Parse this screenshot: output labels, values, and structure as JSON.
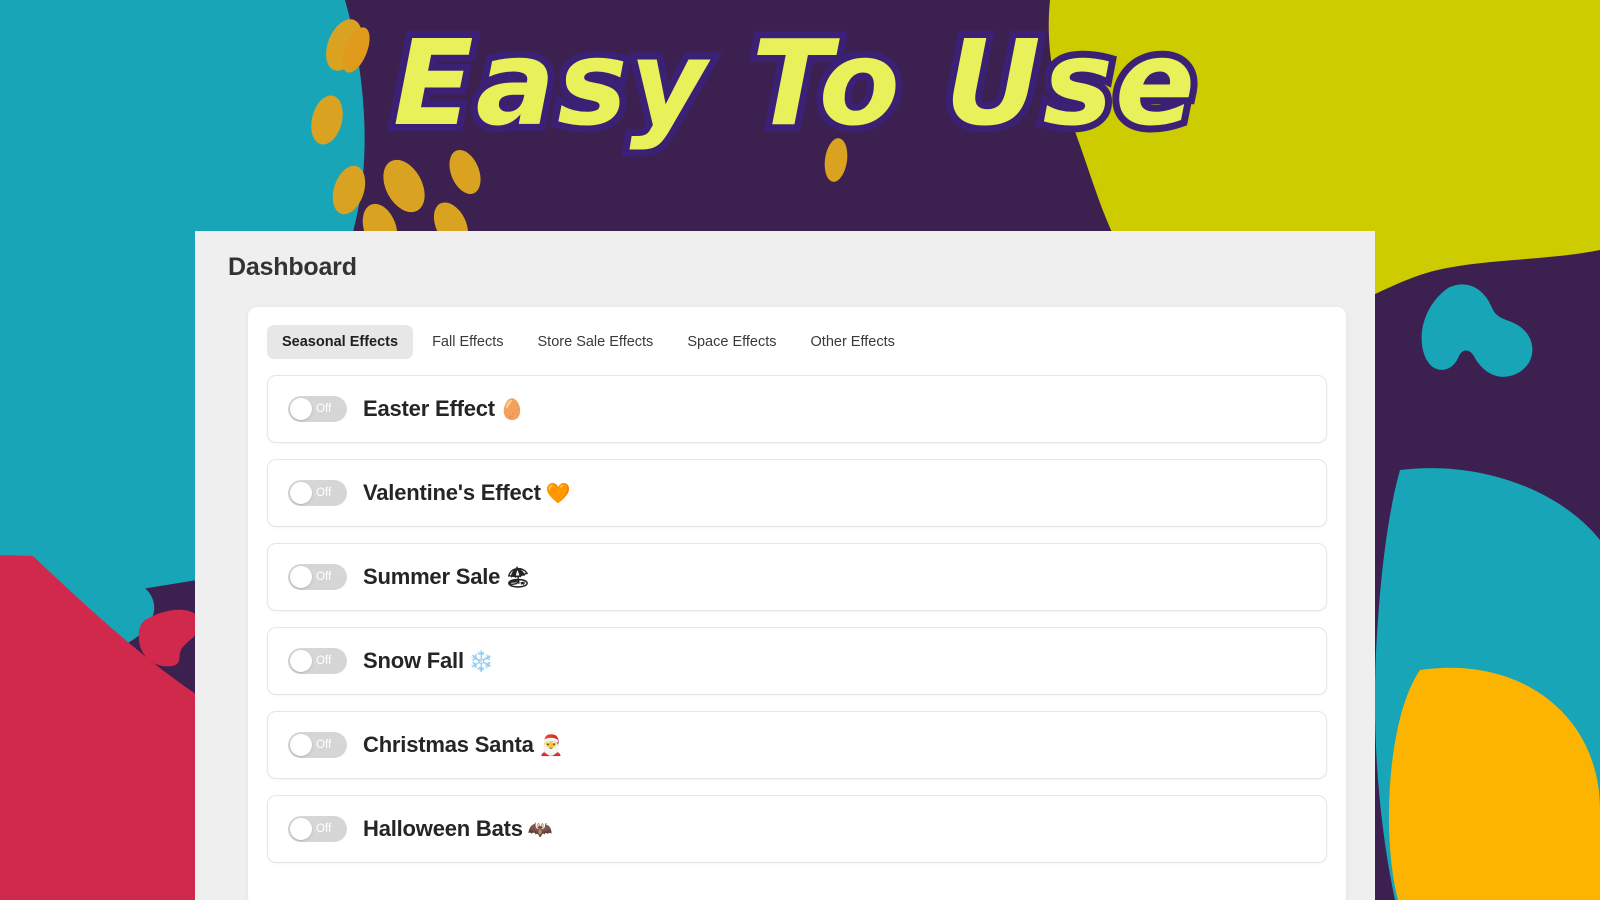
{
  "hero": {
    "headline": "Easy To Use",
    "text_color": "#E8F05A",
    "outline_color": "#3A2175"
  },
  "background": {
    "purple": "#3C2050",
    "teal": "#18A5B8",
    "chartreuse": "#CCCC00",
    "orange": "#FCB400",
    "crimson": "#D0294B",
    "gold": "#D9A321"
  },
  "app": {
    "page_title": "Dashboard",
    "surface_color": "#EFEFEF",
    "tabs": [
      {
        "label": "Seasonal Effects",
        "active": true
      },
      {
        "label": "Fall Effects",
        "active": false
      },
      {
        "label": "Store Sale Effects",
        "active": false
      },
      {
        "label": "Space Effects",
        "active": false
      },
      {
        "label": "Other Effects",
        "active": false
      }
    ],
    "toggle_off_label": "Off",
    "effects": [
      {
        "name": "Easter Effect",
        "emoji": "🥚",
        "state": "Off",
        "icon": "egg-icon"
      },
      {
        "name": "Valentine's Effect",
        "emoji": "🧡",
        "state": "Off",
        "icon": "orange-heart-icon"
      },
      {
        "name": "Summer Sale",
        "emoji": "🏖",
        "state": "Off",
        "icon": "beach-umbrella-icon"
      },
      {
        "name": "Snow Fall",
        "emoji": "❄️",
        "state": "Off",
        "icon": "snowflake-icon"
      },
      {
        "name": "Christmas Santa",
        "emoji": "🎅",
        "state": "Off",
        "icon": "santa-icon"
      },
      {
        "name": "Halloween Bats",
        "emoji": "🦇",
        "state": "Off",
        "icon": "bat-icon"
      }
    ]
  }
}
